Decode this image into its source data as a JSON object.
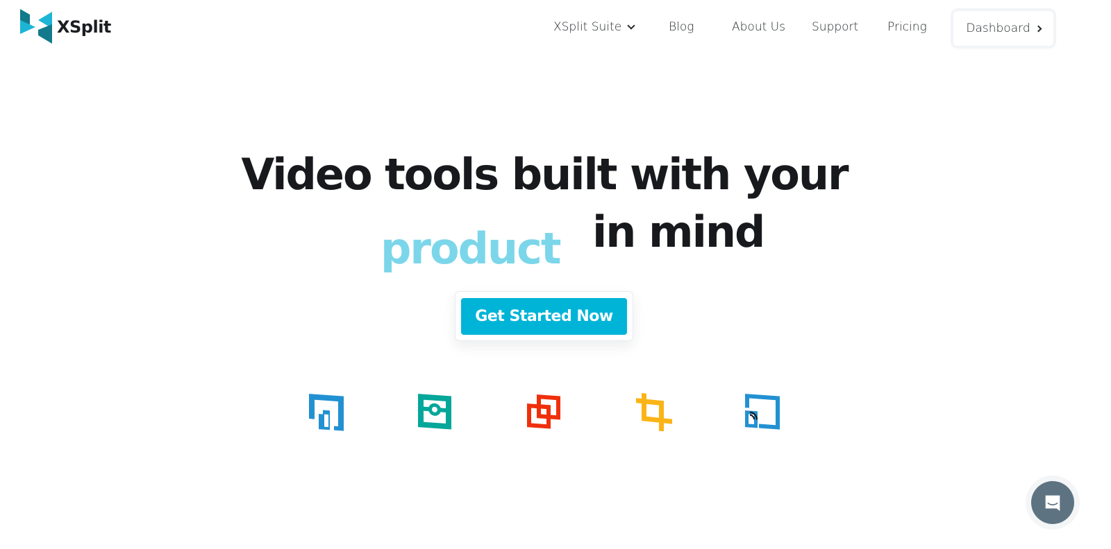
{
  "brand": {
    "name": "XSplit",
    "logo_colors": {
      "primary": "#1cb5d6",
      "dark": "#127a8c"
    }
  },
  "nav": {
    "items": [
      {
        "label": "XSplit Suite",
        "has_dropdown": true
      },
      {
        "label": "Blog"
      },
      {
        "label": "About Us"
      },
      {
        "label": "Support"
      },
      {
        "label": "Pricing"
      }
    ],
    "dashboard_label": "Dashboard"
  },
  "hero": {
    "line1": "Video tools built with your",
    "rotating_word": "product",
    "line2": "in mind",
    "cta_label": "Get Started Now",
    "accent_color": "#7cd6ea",
    "cta_color": "#00b4d8"
  },
  "product_icons": [
    {
      "icon": "broadcaster-icon",
      "color": "#2291d2"
    },
    {
      "icon": "vcam-icon",
      "color": "#04a79a"
    },
    {
      "icon": "presenter-icon",
      "color": "#ef2f0c"
    },
    {
      "icon": "crop-icon",
      "color": "#fbb417"
    },
    {
      "icon": "connect-icon",
      "color": "#2291d2"
    }
  ],
  "chat": {
    "icon": "chat-icon",
    "color": "#5d7382"
  }
}
